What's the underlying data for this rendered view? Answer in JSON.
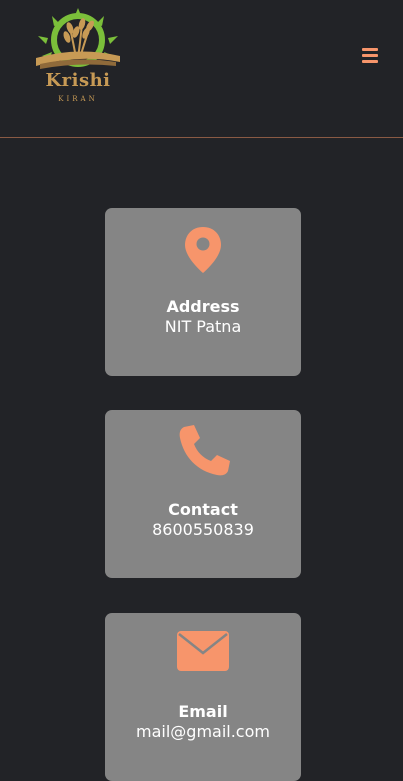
{
  "brand": {
    "name": "Krishi",
    "tagline": "KIRAN"
  },
  "colors": {
    "background": "#222327",
    "accent": "#f7956b",
    "card": "#858585",
    "text": "#ffffff"
  },
  "nav": {
    "menu_icon": "hamburger-icon"
  },
  "cards": [
    {
      "icon": "map-pin-icon",
      "title": "Address",
      "value": "NIT Patna"
    },
    {
      "icon": "phone-icon",
      "title": "Contact",
      "value": "8600550839"
    },
    {
      "icon": "envelope-icon",
      "title": "Email",
      "value": "mail@gmail.com"
    }
  ]
}
